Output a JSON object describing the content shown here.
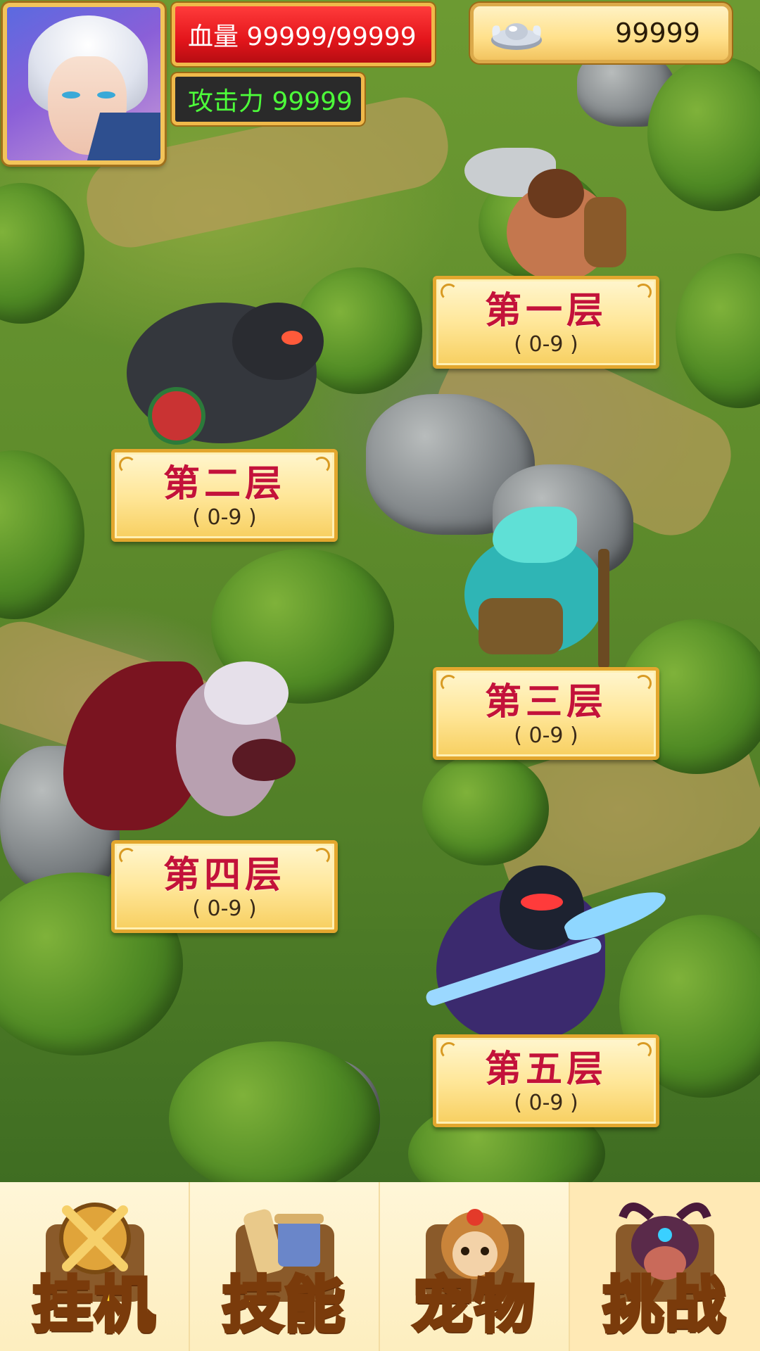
{
  "player": {
    "hp_text": "血量 99999/99999",
    "attack_text": "攻击力 99999",
    "currency_value": "99999"
  },
  "floors": [
    {
      "title": "第一层",
      "range": "( 0-9 )"
    },
    {
      "title": "第二层",
      "range": "( 0-9 )"
    },
    {
      "title": "第三层",
      "range": "( 0-9 )"
    },
    {
      "title": "第四层",
      "range": "( 0-9 )"
    },
    {
      "title": "第五层",
      "range": "( 0-9 )"
    }
  ],
  "nav": [
    {
      "label": "挂机",
      "icon": "crossed-swords-icon"
    },
    {
      "label": "技能",
      "icon": "scroll-icon"
    },
    {
      "label": "宠物",
      "icon": "monkey-pet-icon"
    },
    {
      "label": "挑战",
      "icon": "bull-demon-icon"
    }
  ],
  "colors": {
    "hp_bar": "#e3151b",
    "attack_text": "#4dff3a",
    "floor_title": "#c3123a",
    "nav_label": "#ffcf22",
    "gold_border": "#e3a72e"
  }
}
